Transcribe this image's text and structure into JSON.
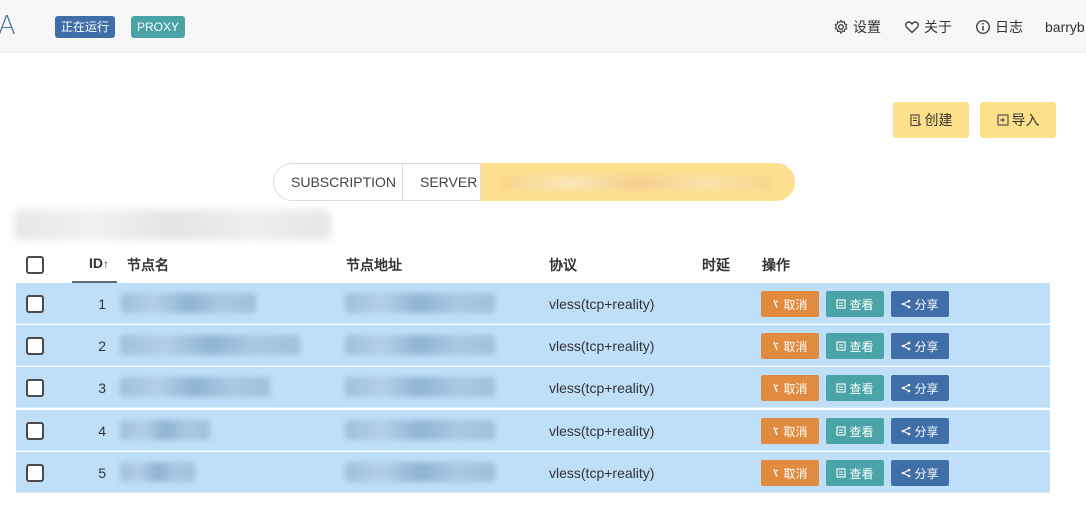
{
  "header": {
    "logo_text": "A",
    "status_badge": "正在运行",
    "mode_badge": "PROXY",
    "nav": {
      "settings": "设置",
      "about": "关于",
      "log": "日志",
      "user": "barryb"
    }
  },
  "toolbar": {
    "create_label": "创建",
    "import_label": "导入"
  },
  "tabs": {
    "subscription": "SUBSCRIPTION",
    "server": "SERVER"
  },
  "table": {
    "columns": {
      "id": "ID",
      "name": "节点名",
      "address": "节点地址",
      "protocol": "协议",
      "latency": "时延",
      "actions": "操作"
    },
    "sort_indicator": "↑",
    "rows": [
      {
        "id": "1",
        "protocol": "vless(tcp+reality)"
      },
      {
        "id": "2",
        "protocol": "vless(tcp+reality)"
      },
      {
        "id": "3",
        "protocol": "vless(tcp+reality)"
      },
      {
        "id": "4",
        "protocol": "vless(tcp+reality)"
      },
      {
        "id": "5",
        "protocol": "vless(tcp+reality)"
      }
    ],
    "row_actions": {
      "cancel": "取消",
      "view": "查看",
      "share": "分享"
    }
  },
  "colors": {
    "selected_row": "#bfdff9",
    "warning_button": "#ffe08a",
    "cancel_button": "#e08b3f",
    "view_button": "#4aa3a6",
    "share_button": "#3f6ea8"
  }
}
